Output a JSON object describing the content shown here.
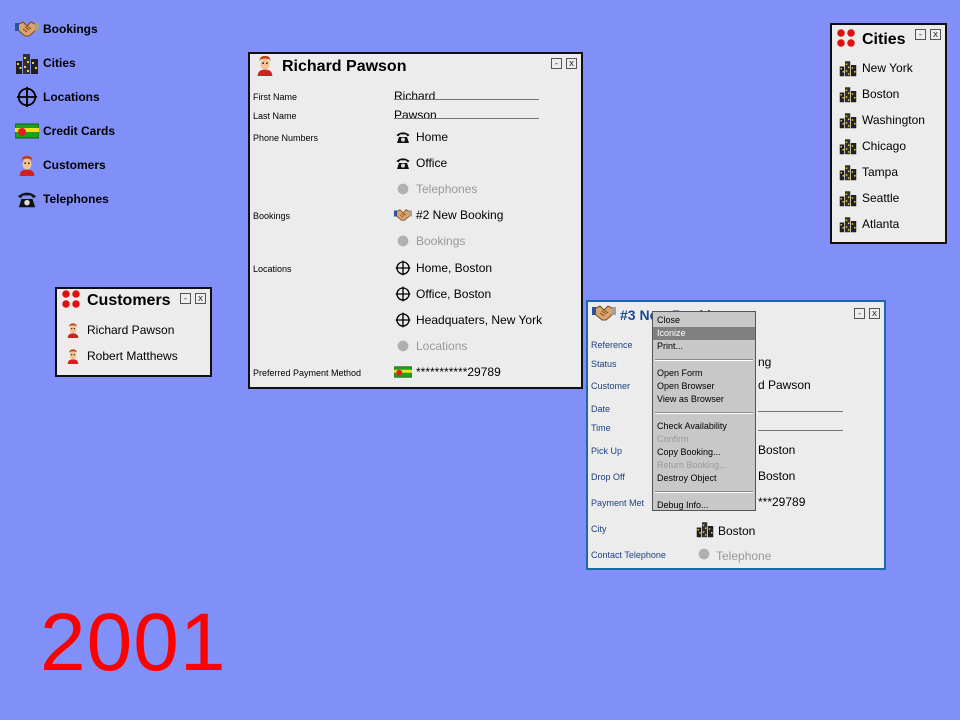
{
  "desktop": {
    "items": [
      {
        "label": "Bookings",
        "icon": "handshake-icon"
      },
      {
        "label": "Cities",
        "icon": "city-icon"
      },
      {
        "label": "Locations",
        "icon": "crosshair-icon"
      },
      {
        "label": "Credit Cards",
        "icon": "credit-card-icon"
      },
      {
        "label": "Customers",
        "icon": "person-icon"
      },
      {
        "label": "Telephones",
        "icon": "telephone-icon"
      }
    ]
  },
  "customers_window": {
    "title": "Customers",
    "items": [
      "Richard Pawson",
      "Robert Matthews"
    ]
  },
  "customer_form": {
    "title": "Richard Pawson",
    "labels": {
      "first_name": "First Name",
      "last_name": "Last Name",
      "phone_numbers": "Phone Numbers",
      "bookings": "Bookings",
      "locations": "Locations",
      "payment": "Preferred Payment Method"
    },
    "first_name": "Richard",
    "last_name": "Pawson",
    "phones": [
      "Home",
      "Office"
    ],
    "phones_placeholder": "Telephones",
    "bookings": [
      "#2 New Booking"
    ],
    "bookings_placeholder": "Bookings",
    "locations": [
      "Home, Boston",
      "Office, Boston",
      "Headquaters, New York"
    ],
    "locations_placeholder": "Locations",
    "payment": "***********29789"
  },
  "cities_window": {
    "title": "Cities",
    "items": [
      "New York",
      "Boston",
      "Washington",
      "Chicago",
      "Tampa",
      "Seattle",
      "Atlanta"
    ]
  },
  "booking_form": {
    "title": "#3 New Booking",
    "labels": {
      "reference": "Reference",
      "status": "Status",
      "customer": "Customer",
      "date": "Date",
      "time": "Time",
      "pickup": "Pick Up",
      "dropoff": "Drop Off",
      "payment": "Payment Met",
      "city": "City",
      "contact": "Contact Telephone"
    },
    "status_partial": "ng",
    "customer_partial": "d Pawson",
    "pickup_partial": "Boston",
    "dropoff_partial": "Boston",
    "payment_partial": "***29789",
    "city": "Boston",
    "contact_placeholder": "Telephone"
  },
  "context_menu": {
    "group1": [
      "Close",
      "Iconize",
      "Print..."
    ],
    "group2": [
      "Open Form",
      "Open Browser",
      "View as Browser"
    ],
    "group3": [
      "Check Availability",
      "Confirm",
      "Copy Booking...",
      "Return Booking...",
      "Destroy Object"
    ],
    "group4": [
      "Debug Info..."
    ],
    "selected": "Iconize",
    "disabled": [
      "Confirm",
      "Return Booking..."
    ]
  },
  "window_buttons": {
    "minimize": "-",
    "close": "x"
  },
  "year": "2001",
  "colors": {
    "background": "#8090f8",
    "year": "#ff0000",
    "label_blue": "#204080"
  }
}
